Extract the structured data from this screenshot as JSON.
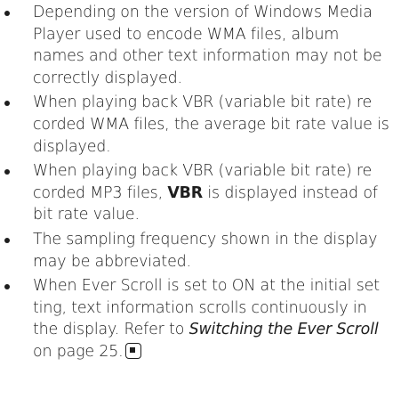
{
  "notes": [
    {
      "lines": [
        "Depending on the version of Windows Media",
        "Player used to encode WMA files, album",
        "names and other text information may not be",
        "correctly displayed."
      ]
    },
    {
      "lines": [
        "When playing back VBR (variable bit rate) re",
        "corded WMA files, the average bit rate value is",
        "displayed."
      ]
    },
    {
      "line1": "When playing back VBR (variable bit rate) re",
      "line2_pre": "corded MP3 files, ",
      "line2_bold": "VBR",
      "line2_post": " is displayed instead of",
      "line3": "bit rate value."
    },
    {
      "lines": [
        "The sampling frequency shown in the display",
        "may be abbreviated."
      ]
    },
    {
      "line1": "When Ever Scroll is set to ON at the initial set",
      "line2": "ting, text information scrolls continuously in",
      "line3_pre": "the display. Refer to ",
      "line3_ref": "Switching the Ever Scroll",
      "line4": "on page 25."
    }
  ],
  "end_mark_icon": "end-of-section-icon"
}
